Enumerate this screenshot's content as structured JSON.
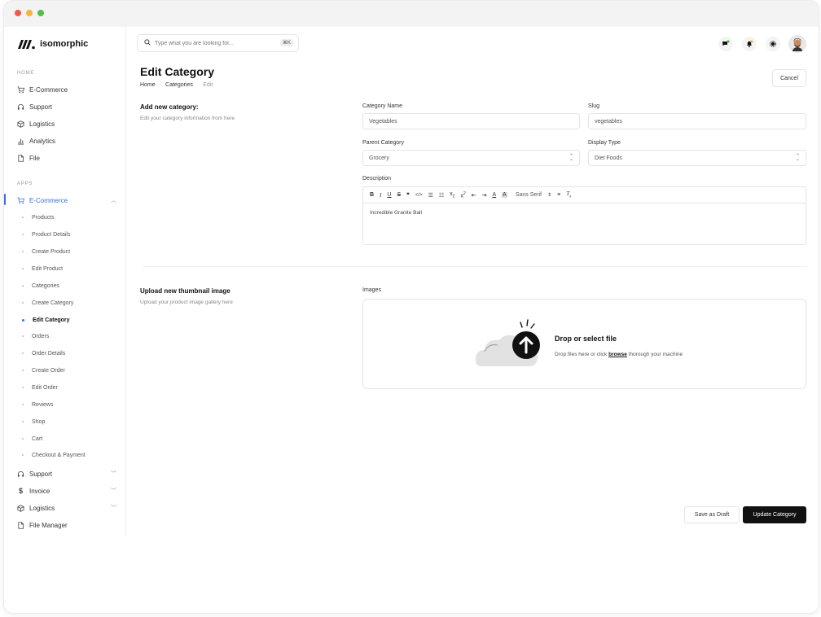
{
  "app": {
    "name": "isomorphic"
  },
  "sidebar": {
    "home_label": "HOME",
    "home_items": [
      {
        "label": "E-Commerce",
        "icon": "cart-icon"
      },
      {
        "label": "Support",
        "icon": "headset-icon"
      },
      {
        "label": "Logistics",
        "icon": "box-icon"
      },
      {
        "label": "Analytics",
        "icon": "chart-icon"
      },
      {
        "label": "File",
        "icon": "file-icon"
      }
    ],
    "apps_label": "APPS",
    "apps_active": {
      "label": "E-Commerce",
      "icon": "cart-icon"
    },
    "ecommerce_sub": [
      "Products",
      "Product Details",
      "Create Product",
      "Edit Product",
      "Categories",
      "Create Category",
      "Edit Category",
      "Orders",
      "Order Details",
      "Create Order",
      "Edit Order",
      "Reviews",
      "Shop",
      "Cart",
      "Checkout & Payment"
    ],
    "active_sub": "Edit Category",
    "apps_more": [
      {
        "label": "Support",
        "icon": "headset-icon"
      },
      {
        "label": "Invoice",
        "icon": "dollar-icon"
      },
      {
        "label": "Logistics",
        "icon": "box-icon"
      },
      {
        "label": "File Manager",
        "icon": "file-icon"
      }
    ]
  },
  "header": {
    "search_placeholder": "Type what you are looking for...",
    "search_shortcut": "⌘K"
  },
  "page": {
    "title": "Edit Category",
    "breadcrumb": [
      "Home",
      "Categories",
      "Edit"
    ],
    "cancel_label": "Cancel"
  },
  "form": {
    "section1_title": "Add new category:",
    "section1_desc": "Edit your category information from here",
    "category_name_label": "Category Name",
    "category_name_value": "Vegetables",
    "slug_label": "Slug",
    "slug_value": "vegetables",
    "parent_category_label": "Parent Category",
    "parent_category_value": "Grocery",
    "display_type_label": "Display Type",
    "display_type_value": "Diet Foods",
    "description_label": "Description",
    "description_value": "Incredible Granite Ball",
    "toolbar_font": "Sans Serif",
    "section2_title": "Upload new thumbnail image",
    "section2_desc": "Upload your product image gallery here",
    "images_label": "Images",
    "drop_title": "Drop or select file",
    "drop_desc_pre": "Drop files here or click ",
    "drop_desc_link": "browse",
    "drop_desc_post": " thorough your machine",
    "save_draft_label": "Save as Draft",
    "update_label": "Update Category"
  }
}
